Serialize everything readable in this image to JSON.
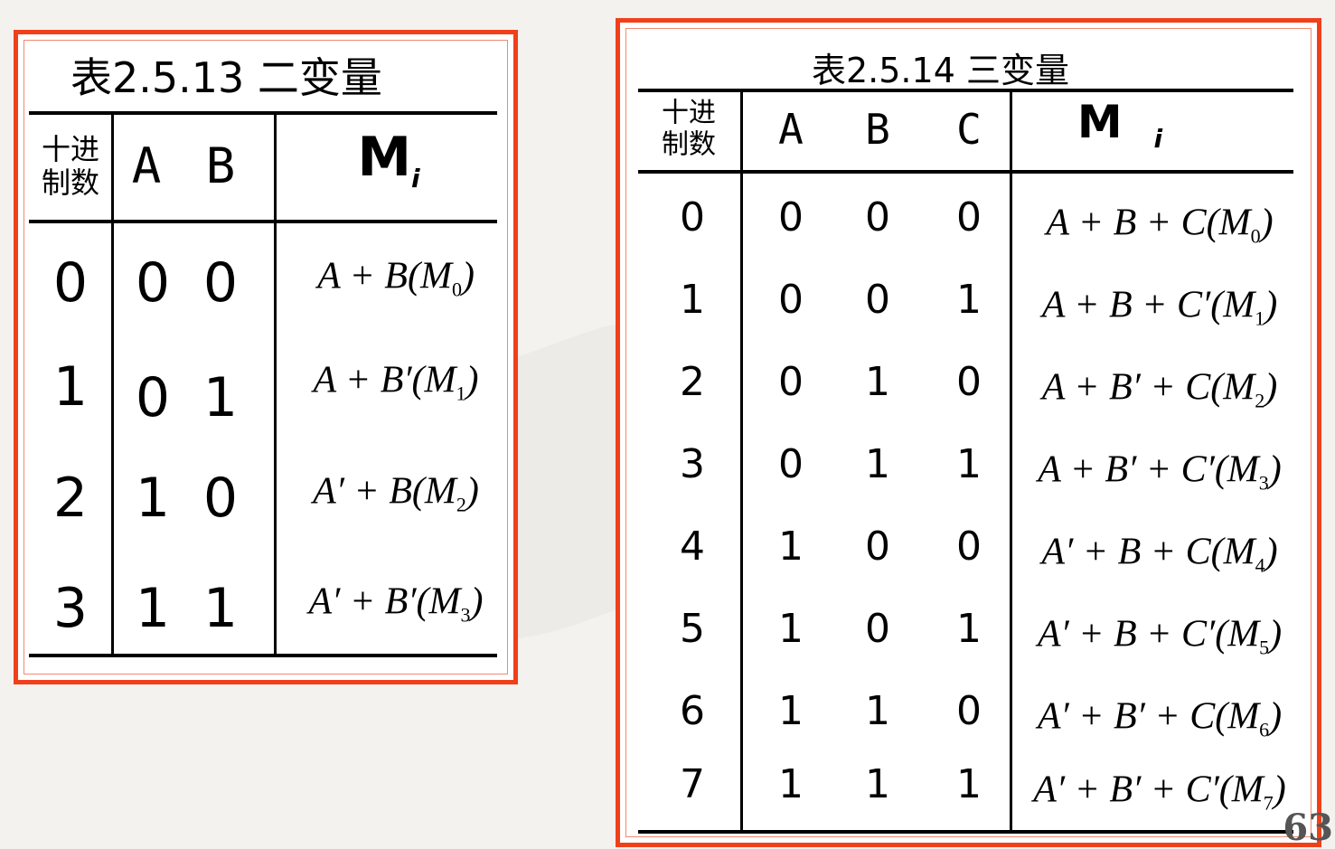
{
  "table_left": {
    "title": "表2.5.13  二变量",
    "headers": {
      "dec": "十进\n制数",
      "a": "A",
      "b": "B",
      "m": "M",
      "m_sub": "i"
    },
    "rows": [
      {
        "dec": "0",
        "a": "0",
        "b": "0",
        "expr": "A + B(M",
        "sub": "0",
        "close": ")"
      },
      {
        "dec": "1",
        "a": "0",
        "b": "1",
        "expr": "A + B′(M",
        "sub": "1",
        "close": ")"
      },
      {
        "dec": "2",
        "a": "1",
        "b": "0",
        "expr": "A′ + B(M",
        "sub": "2",
        "close": ")"
      },
      {
        "dec": "3",
        "a": "1",
        "b": "1",
        "expr": "A′ + B′(M",
        "sub": "3",
        "close": ")"
      }
    ]
  },
  "table_right": {
    "title": "表2.5.14  三变量",
    "headers": {
      "dec": "十进\n制数",
      "a": "A",
      "b": "B",
      "c": "C",
      "m": "M",
      "m_sub": "i"
    },
    "rows": [
      {
        "dec": "0",
        "a": "0",
        "b": "0",
        "c": "0",
        "expr": "A + B + C(M",
        "sub": "0",
        "close": ")"
      },
      {
        "dec": "1",
        "a": "0",
        "b": "0",
        "c": "1",
        "expr": "A + B + C′(M",
        "sub": "1",
        "close": ")"
      },
      {
        "dec": "2",
        "a": "0",
        "b": "1",
        "c": "0",
        "expr": "A + B′ + C(M",
        "sub": "2",
        "close": ")"
      },
      {
        "dec": "3",
        "a": "0",
        "b": "1",
        "c": "1",
        "expr": "A + B′ + C′(M",
        "sub": "3",
        "close": ")"
      },
      {
        "dec": "4",
        "a": "1",
        "b": "0",
        "c": "0",
        "expr": "A′ + B + C(M",
        "sub": "4",
        "close": ")"
      },
      {
        "dec": "5",
        "a": "1",
        "b": "0",
        "c": "1",
        "expr": "A′ + B + C′(M",
        "sub": "5",
        "close": ")"
      },
      {
        "dec": "6",
        "a": "1",
        "b": "1",
        "c": "0",
        "expr": "A′ + B′ + C(M",
        "sub": "6",
        "close": ")"
      },
      {
        "dec": "7",
        "a": "1",
        "b": "1",
        "c": "1",
        "expr": "A′ + B′ + C′(M",
        "sub": "7",
        "close": ")"
      }
    ]
  },
  "page_number": "63",
  "colors": {
    "frame": "#f0401a",
    "background": "#f3f2ef"
  }
}
